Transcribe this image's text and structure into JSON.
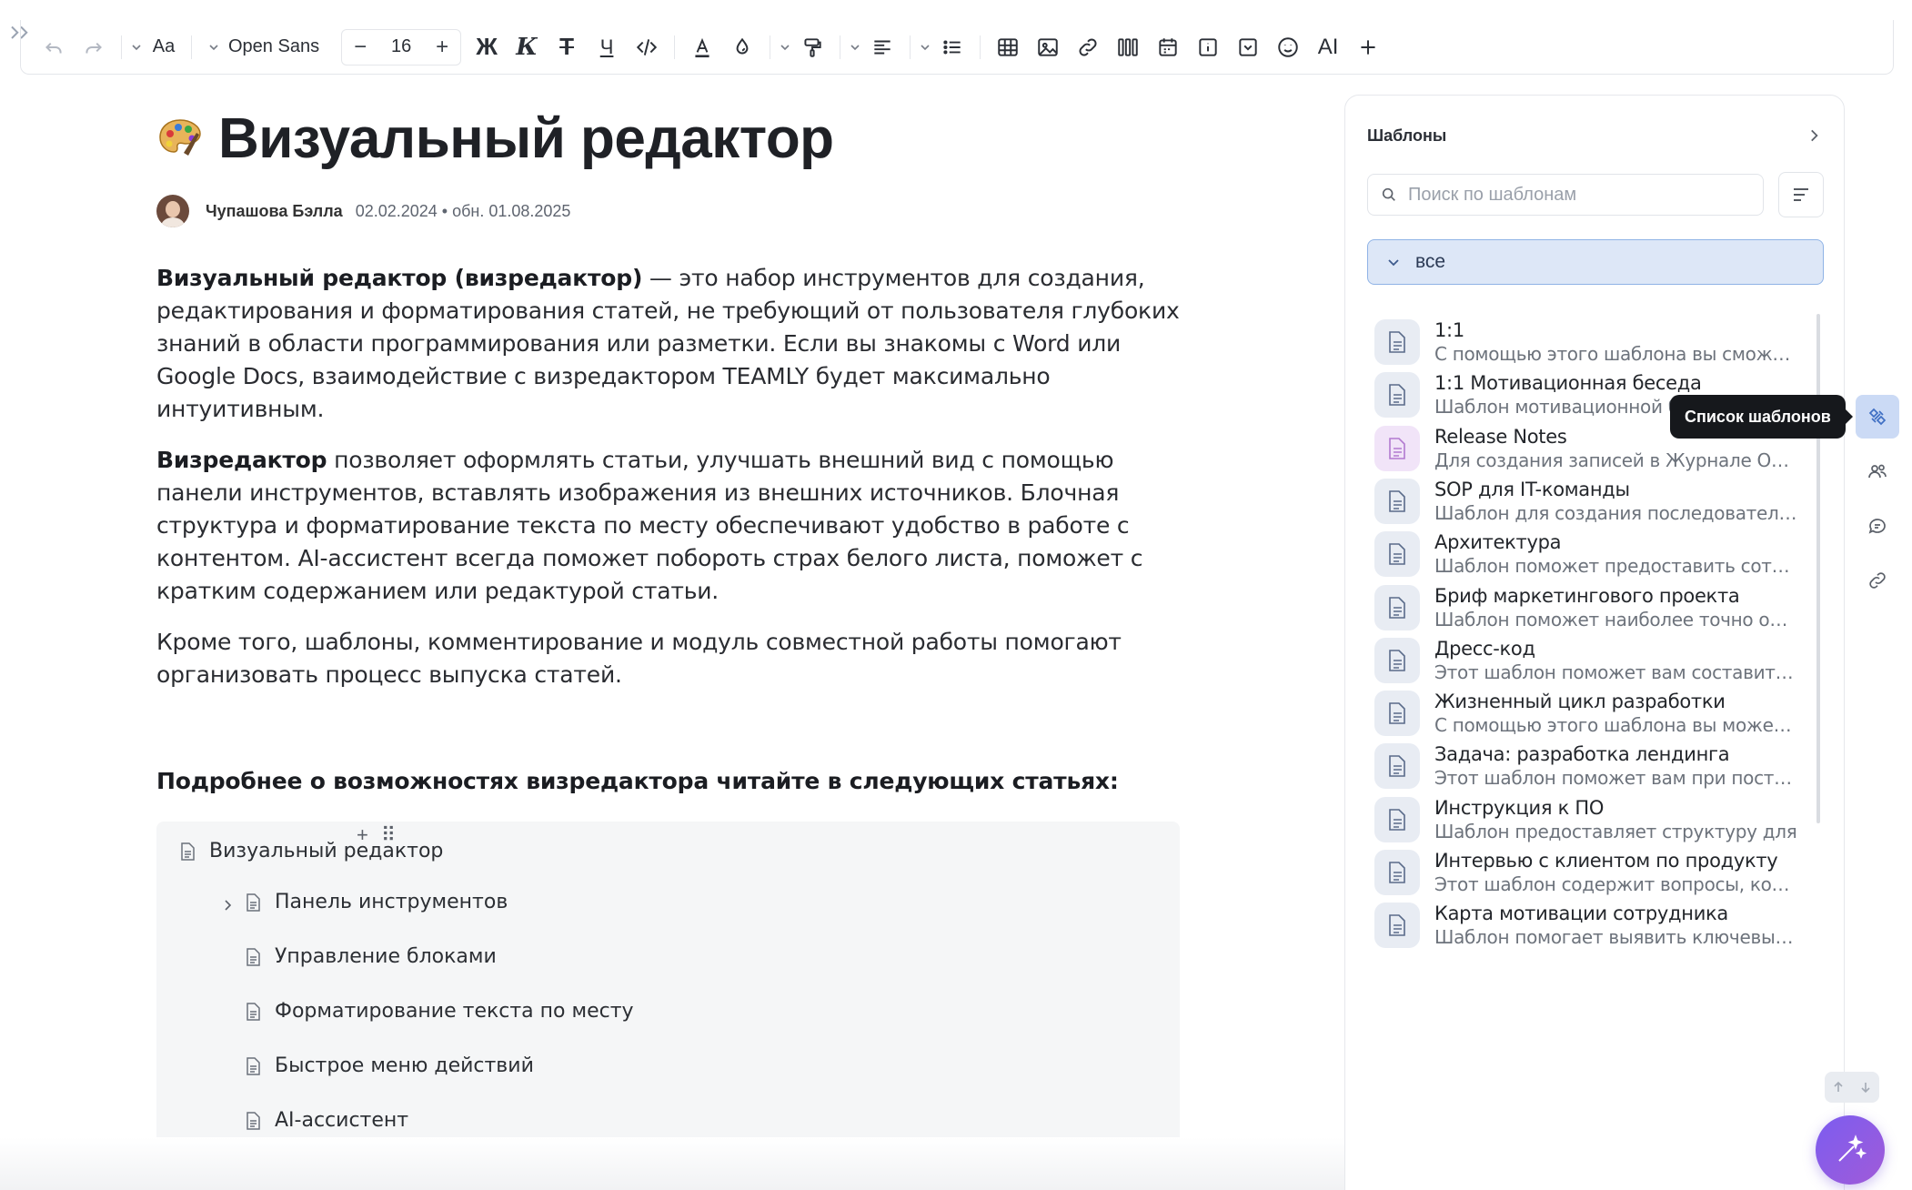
{
  "toolbar": {
    "font_family": "Open Sans",
    "font_size": "16",
    "bold_label": "Ж",
    "italic_label": "К",
    "strike_label": "Т",
    "underline_label": "Ч",
    "ai_label": "AI",
    "text_style_label": "Aa"
  },
  "article": {
    "title": "Визуальный редактор",
    "author": "Чупашова Бэлла",
    "dates": "02.02.2024 • обн. 01.08.2025",
    "p1_bold": "Визуальный редактор (визредактор)",
    "p1_rest": " — это набор инструментов для создания, редактирования и форматирования статей, не требующий от пользователя глубоких знаний в области программирования или разметки. Если вы знакомы с Word или Google Docs, взаимодействие с визредактором TEAMLY будет максимально интуитивным.",
    "p2_bold": "Визредактор",
    "p2_rest": " позволяет оформлять статьи, улучшать внешний вид с помощью панели инструментов, вставлять изображения из внешних источников. Блочная структура и форматирование текста по месту обеспечивают удобство в работе с контентом. AI-ассистент всегда поможет побороть страх белого листа, поможет с кратким содержанием или редактурой статьи.",
    "p3": "Кроме того, шаблоны, комментирование и модуль совместной работы помогают организовать процесс выпуска статей.",
    "subhead": "Подробнее о возможностях визредактора читайте в следующих статьях:",
    "toc": {
      "root": "Визуальный редактор",
      "children": [
        "Панель инструментов",
        "Управление блоками",
        "Форматирование текста по месту",
        "Быстрое меню действий",
        "AI-ассистент"
      ]
    }
  },
  "templates": {
    "title": "Шаблоны",
    "search_placeholder": "Поиск по шаблонам",
    "filter_label": "все",
    "items": [
      {
        "name": "1:1",
        "desc": "С помощью этого шаблона вы сможете провести встречу"
      },
      {
        "name": "1:1 Мотивационная беседа",
        "desc": "Шаблон мотивационной беседы"
      },
      {
        "name": "Release Notes",
        "desc": "Для создания записей в Журнале Обновлений"
      },
      {
        "name": "SOP для IT-команды",
        "desc": "Шаблон для создания последовательности"
      },
      {
        "name": "Архитектура",
        "desc": "Шаблон поможет предоставить сотрудникам"
      },
      {
        "name": "Бриф маркетингового проекта",
        "desc": "Шаблон поможет наиболее точно обозначить"
      },
      {
        "name": "Дресс-код",
        "desc": "Этот шаблон поможет вам составить правила"
      },
      {
        "name": "Жизненный цикл разработки",
        "desc": "С помощью этого шаблона вы можете описать"
      },
      {
        "name": "Задача: разработка лендинга",
        "desc": "Этот шаблон поможет вам при постановке"
      },
      {
        "name": "Инструкция к ПО",
        "desc": "Шаблон предоставляет структуру для"
      },
      {
        "name": "Интервью с клиентом по продукту",
        "desc": "Этот шаблон содержит вопросы, которые"
      },
      {
        "name": "Карта мотивации сотрудника",
        "desc": "Шаблон помогает выявить ключевые мотивы"
      }
    ]
  },
  "tooltip": "Список шаблонов",
  "colors": {
    "accent": "#3f6fc4",
    "filter_bg": "#dde7f7",
    "fab_start": "#7c5cf0",
    "fab_end": "#a05bd8"
  }
}
